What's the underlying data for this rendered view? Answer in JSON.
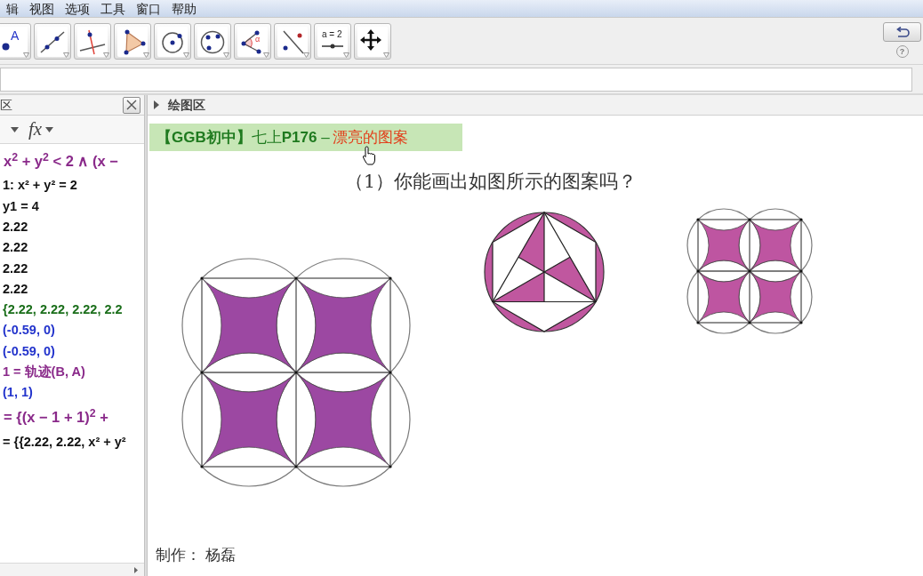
{
  "menu_bar": [
    "辑",
    "视图",
    "选项",
    "工具",
    "窗口",
    "帮助"
  ],
  "toolbar": {
    "tools": [
      {
        "kind": "point",
        "label": "A",
        "selected": false
      },
      {
        "kind": "line",
        "selected": false
      },
      {
        "kind": "perpendicular",
        "selected": false
      },
      {
        "kind": "polygon",
        "selected": false
      },
      {
        "kind": "circle_center",
        "selected": false
      },
      {
        "kind": "circle_points",
        "selected": false
      },
      {
        "kind": "angle",
        "label": "α",
        "selected": false
      },
      {
        "kind": "reflect",
        "selected": false
      },
      {
        "kind": "slider",
        "label": "a = 2",
        "selected": false
      },
      {
        "kind": "move_view",
        "selected": false
      }
    ],
    "help": "?"
  },
  "algebra_view": {
    "title": "区",
    "input_help": "fx",
    "entries": [
      {
        "kind": "formula",
        "color": "#8a2a8a",
        "text": "x$^{2}$ + y$^{2}$ < 2 ∧ (x −"
      },
      {
        "kind": "text",
        "color": "#111111",
        "text": "1: x² + y² = 2"
      },
      {
        "kind": "text",
        "color": "#111111",
        "text": "y1 = 4"
      },
      {
        "kind": "text",
        "color": "#111111",
        "text": "2.22"
      },
      {
        "kind": "text",
        "color": "#111111",
        "text": "2.22"
      },
      {
        "kind": "text",
        "color": "#111111",
        "text": "2.22"
      },
      {
        "kind": "text",
        "color": "#111111",
        "text": "2.22"
      },
      {
        "kind": "text",
        "color": "#1a6e1a",
        "text": "{2.22, 2.22, 2.22, 2.2"
      },
      {
        "kind": "text",
        "color": "#2233cc",
        "text": "(-0.59, 0)"
      },
      {
        "kind": "text",
        "color": "#2233cc",
        "text": "(-0.59, 0)"
      },
      {
        "kind": "text",
        "color": "#8a2a8a",
        "text": "1 = 轨迹(B, A)"
      },
      {
        "kind": "text",
        "color": "#2233cc",
        "text": "(1, 1)"
      },
      {
        "kind": "formula",
        "color": "#8a2a8a",
        "text": "= {(x − 1 + 1)$^{2}$ +"
      },
      {
        "kind": "text",
        "color": "#111111",
        "text": "= {{2.22, 2.22, x² + y²"
      }
    ]
  },
  "graphics_view": {
    "title": "绘图区",
    "banner": {
      "text": "**【GGB初中】**七上**P176** –",
      "highlight": "漂亮的图案"
    },
    "question": "（1）你能画出如图所示的图案吗？",
    "figures": [
      {
        "kind": "circle_grid"
      },
      {
        "kind": "hexagon_triangle"
      },
      {
        "kind": "circle_grid"
      }
    ],
    "credit": "制作： 杨磊"
  }
}
